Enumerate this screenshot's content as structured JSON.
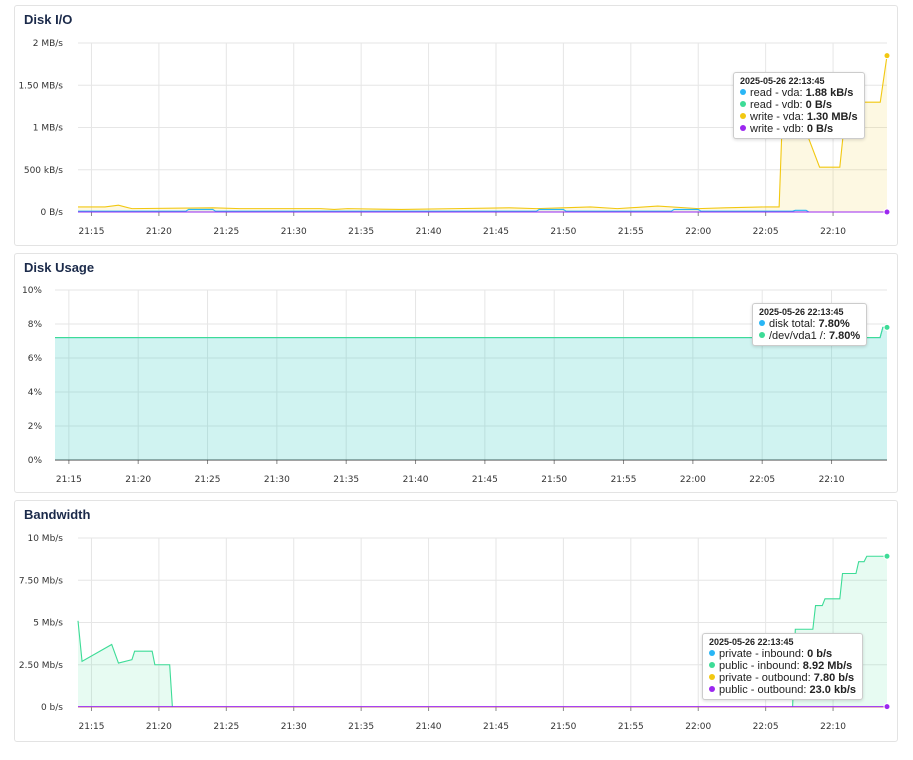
{
  "x_ticks": [
    "21:15",
    "21:20",
    "21:25",
    "21:30",
    "21:35",
    "21:40",
    "21:45",
    "21:50",
    "21:55",
    "22:00",
    "22:05",
    "22:10"
  ],
  "colors": {
    "read_vda": "#29b6f6",
    "read_vdb": "#3ddc97",
    "write_vda": "#f2c811",
    "write_vdb": "#9c27f0",
    "grid": "#e6e6e6"
  },
  "disk_io": {
    "title": "Disk I/O",
    "y_ticks": [
      "2 MB/s",
      "1.50 MB/s",
      "1 MB/s",
      "500 kB/s",
      "0 B/s"
    ],
    "tooltip": {
      "time": "2025-05-26 22:13:45",
      "rows": [
        {
          "label": "read - vda:",
          "value": "1.88 kB/s",
          "color": "#29b6f6"
        },
        {
          "label": "read - vdb:",
          "value": "0 B/s",
          "color": "#3ddc97"
        },
        {
          "label": "write - vda:",
          "value": "1.30 MB/s",
          "color": "#f2c811"
        },
        {
          "label": "write - vdb:",
          "value": "0 B/s",
          "color": "#9c27f0"
        }
      ]
    }
  },
  "disk_usage": {
    "title": "Disk Usage",
    "y_ticks": [
      "10%",
      "8%",
      "6%",
      "4%",
      "2%",
      "0%"
    ],
    "tooltip": {
      "time": "2025-05-26 22:13:45",
      "rows": [
        {
          "label": "disk total:",
          "value": "7.80%",
          "color": "#29b6f6"
        },
        {
          "label": "/dev/vda1 /:",
          "value": "7.80%",
          "color": "#3ddc97"
        }
      ]
    }
  },
  "bandwidth": {
    "title": "Bandwidth",
    "y_ticks": [
      "10 Mb/s",
      "7.50 Mb/s",
      "5 Mb/s",
      "2.50 Mb/s",
      "0 b/s"
    ],
    "tooltip": {
      "time": "2025-05-26 22:13:45",
      "rows": [
        {
          "label": "private - inbound:",
          "value": "0 b/s",
          "color": "#29b6f6"
        },
        {
          "label": "public - inbound:",
          "value": "8.92 Mb/s",
          "color": "#3ddc97"
        },
        {
          "label": "private - outbound:",
          "value": "7.80 b/s",
          "color": "#f2c811"
        },
        {
          "label": "public - outbound:",
          "value": "23.0 kb/s",
          "color": "#9c27f0"
        }
      ]
    }
  },
  "chart_data": [
    {
      "type": "area",
      "title": "Disk I/O",
      "x_range": [
        "21:14",
        "22:14"
      ],
      "ylim": [
        0,
        2
      ],
      "y_unit": "MB/s",
      "series": [
        {
          "name": "write - vda",
          "color": "#f2c811",
          "points": [
            [
              "21:14",
              0.06
            ],
            [
              "21:16",
              0.06
            ],
            [
              "21:17",
              0.08
            ],
            [
              "21:18",
              0.04
            ],
            [
              "21:24",
              0.05
            ],
            [
              "21:26",
              0.04
            ],
            [
              "21:32",
              0.04
            ],
            [
              "21:33",
              0.03
            ],
            [
              "21:34",
              0.04
            ],
            [
              "21:38",
              0.03
            ],
            [
              "21:42",
              0.04
            ],
            [
              "21:46",
              0.05
            ],
            [
              "21:48",
              0.04
            ],
            [
              "21:50",
              0.05
            ],
            [
              "21:52",
              0.06
            ],
            [
              "21:54",
              0.04
            ],
            [
              "21:56",
              0.06
            ],
            [
              "21:57",
              0.07
            ],
            [
              "22:00",
              0.04
            ],
            [
              "22:02",
              0.05
            ],
            [
              "22:05",
              0.06
            ],
            [
              "22:06",
              0.06
            ],
            [
              "22:06.2",
              0.95
            ],
            [
              "22:08",
              0.95
            ],
            [
              "22:09",
              0.53
            ],
            [
              "22:10.5",
              0.53
            ],
            [
              "22:11",
              1.3
            ],
            [
              "22:13.5",
              1.3
            ],
            [
              "22:14",
              1.85
            ]
          ]
        },
        {
          "name": "read - vda",
          "color": "#29b6f6",
          "points": [
            [
              "21:14",
              0.01
            ],
            [
              "21:22",
              0.01
            ],
            [
              "21:22.2",
              0.03
            ],
            [
              "21:24",
              0.03
            ],
            [
              "21:24.2",
              0.01
            ],
            [
              "21:48",
              0.01
            ],
            [
              "21:48.2",
              0.03
            ],
            [
              "21:50",
              0.03
            ],
            [
              "21:50.2",
              0.01
            ],
            [
              "21:58",
              0.01
            ],
            [
              "21:58.2",
              0.03
            ],
            [
              "22:00",
              0.03
            ],
            [
              "22:00.2",
              0.01
            ],
            [
              "22:07",
              0.01
            ],
            [
              "22:07.2",
              0.02
            ],
            [
              "22:08",
              0.02
            ],
            [
              "22:08.2",
              0.0
            ],
            [
              "22:14",
              0.0
            ]
          ]
        },
        {
          "name": "read - vdb",
          "color": "#3ddc97",
          "points": [
            [
              "21:14",
              0.0
            ],
            [
              "22:14",
              0.0
            ]
          ]
        },
        {
          "name": "write - vdb",
          "color": "#9c27f0",
          "points": [
            [
              "21:14",
              0.0
            ],
            [
              "22:14",
              0.0
            ]
          ]
        }
      ]
    },
    {
      "type": "area",
      "title": "Disk Usage",
      "x_range": [
        "21:14",
        "22:14"
      ],
      "ylim": [
        0,
        10
      ],
      "y_unit": "%",
      "series": [
        {
          "name": "disk total",
          "color": "#29b6f6",
          "points": [
            [
              "21:14",
              7.2
            ],
            [
              "22:13.5",
              7.2
            ],
            [
              "22:13.7",
              7.8
            ],
            [
              "22:14",
              7.8
            ]
          ]
        },
        {
          "name": "/dev/vda1 /",
          "color": "#3ddc97",
          "points": [
            [
              "21:14",
              7.2
            ],
            [
              "22:13.5",
              7.2
            ],
            [
              "22:13.7",
              7.8
            ],
            [
              "22:14",
              7.8
            ]
          ]
        }
      ]
    },
    {
      "type": "area",
      "title": "Bandwidth",
      "x_range": [
        "21:14",
        "22:14"
      ],
      "ylim": [
        0,
        10
      ],
      "y_unit": "Mb/s",
      "series": [
        {
          "name": "public - inbound",
          "color": "#3ddc97",
          "points": [
            [
              "21:14",
              5.1
            ],
            [
              "21:14.3",
              2.7
            ],
            [
              "21:16.5",
              3.7
            ],
            [
              "21:17",
              2.6
            ],
            [
              "21:18",
              2.8
            ],
            [
              "21:18.2",
              3.3
            ],
            [
              "21:19.5",
              3.3
            ],
            [
              "21:19.7",
              2.5
            ],
            [
              "21:20.8",
              2.5
            ],
            [
              "21:21",
              0.0
            ],
            [
              "22:07",
              0.0
            ],
            [
              "22:07.2",
              4.6
            ],
            [
              "22:08.5",
              4.6
            ],
            [
              "22:08.7",
              6.0
            ],
            [
              "22:09.2",
              6.0
            ],
            [
              "22:09.4",
              6.4
            ],
            [
              "22:10.5",
              6.4
            ],
            [
              "22:10.7",
              7.9
            ],
            [
              "22:11.7",
              7.9
            ],
            [
              "22:11.9",
              8.6
            ],
            [
              "22:12.3",
              8.6
            ],
            [
              "22:12.5",
              8.92
            ],
            [
              "22:14",
              8.92
            ]
          ]
        },
        {
          "name": "private - inbound",
          "color": "#29b6f6",
          "points": [
            [
              "21:14",
              0.0
            ],
            [
              "22:14",
              0.0
            ]
          ]
        },
        {
          "name": "private - outbound",
          "color": "#f2c811",
          "points": [
            [
              "21:14",
              0.0
            ],
            [
              "22:14",
              0.0
            ]
          ]
        },
        {
          "name": "public - outbound",
          "color": "#9c27f0",
          "points": [
            [
              "21:14",
              0.02
            ],
            [
              "22:14",
              0.02
            ]
          ]
        }
      ]
    }
  ]
}
